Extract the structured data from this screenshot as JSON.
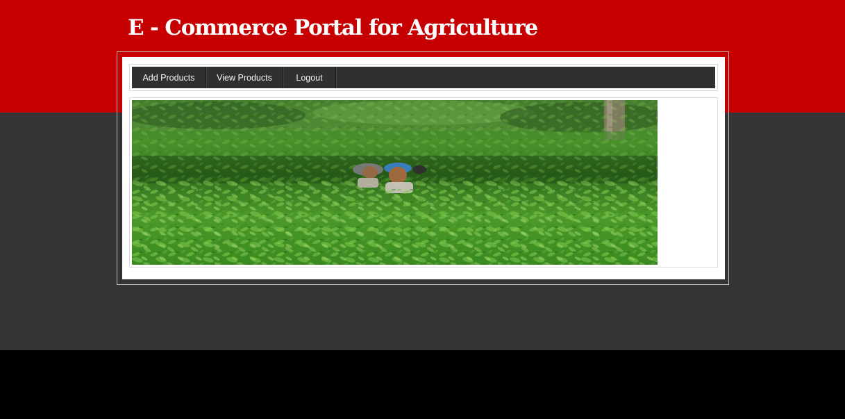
{
  "header": {
    "title": "E - Commerce Portal for Agriculture"
  },
  "nav": {
    "items": [
      {
        "label": "Add Products"
      },
      {
        "label": "View Products"
      },
      {
        "label": "Logout"
      }
    ]
  },
  "hero": {
    "description": "photo-tea-plantation-workers"
  },
  "colors": {
    "header_bg": "#c60000",
    "body_bg": "#343434",
    "footer_bg": "#000000",
    "nav_bg": "#303030",
    "panel_bg": "#ffffff"
  }
}
